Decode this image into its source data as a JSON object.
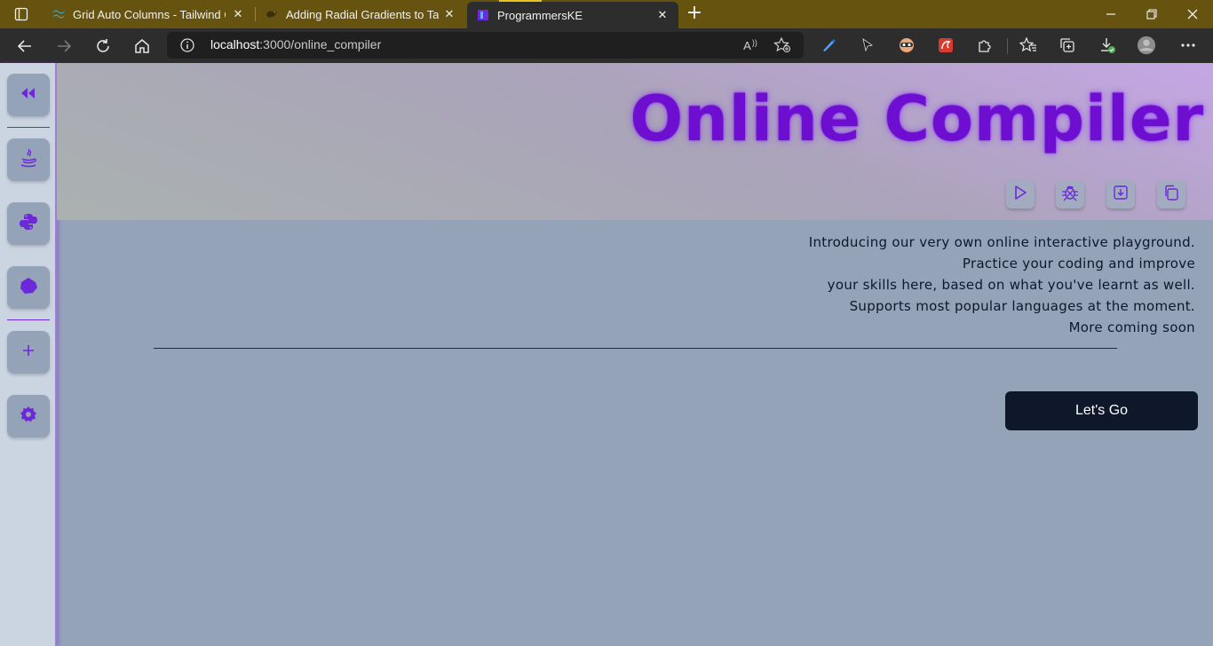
{
  "browser": {
    "tabs": [
      {
        "title": "Grid Auto Columns - Tailwind CSS",
        "favicon": "tailwind-icon",
        "active": false
      },
      {
        "title": "Adding Radial Gradients to Tailwind",
        "favicon": "bird-icon",
        "active": false
      },
      {
        "title": "ProgrammersKE",
        "favicon": "programmerske-icon",
        "active": true
      }
    ],
    "url_host": "localhost",
    "url_path": ":3000/online_compiler",
    "read_aloud_label": "A",
    "colors": {
      "tabbar": "#665310",
      "toolbar": "#2d2d2d"
    }
  },
  "sidebar": {
    "items": [
      {
        "name": "collapse",
        "icon": "double-chevron-left-icon"
      },
      {
        "name": "java",
        "icon": "java-icon"
      },
      {
        "name": "python",
        "icon": "python-icon"
      },
      {
        "name": "shape",
        "icon": "blob-icon"
      },
      {
        "name": "add",
        "icon": "plus-icon"
      },
      {
        "name": "settings",
        "icon": "settings-gear-icon"
      }
    ],
    "accent": "#6d28d9"
  },
  "header": {
    "title": "Online Compiler",
    "tools": [
      {
        "name": "run",
        "icon": "play-icon"
      },
      {
        "name": "debug",
        "icon": "bug-icon"
      },
      {
        "name": "download",
        "icon": "download-icon"
      },
      {
        "name": "copy",
        "icon": "copy-icon"
      }
    ]
  },
  "intro": {
    "lines": [
      "Introducing our very own online interactive playground.",
      "Practice your coding and improve",
      "your skills here, based on what you've learnt as well.",
      "Supports most popular languages at the moment.",
      "More coming soon"
    ]
  },
  "cta": {
    "label": "Let's Go"
  }
}
